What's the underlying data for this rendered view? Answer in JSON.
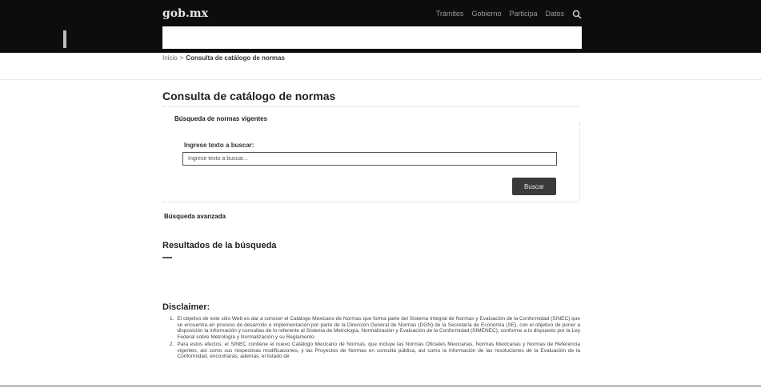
{
  "header": {
    "logo": "gob.mx",
    "nav": [
      "Trámites",
      "Gobierno",
      "Participa",
      "Datos"
    ],
    "search_icon": "search-icon"
  },
  "breadcrumb": {
    "home": "Inicio",
    "separator": ">",
    "current": "Consulta de catálogo de normas"
  },
  "page": {
    "title": "Consulta de catálogo de normas"
  },
  "search": {
    "section_label": "Búsqueda de normas vigentes",
    "field_label": "Ingrese texto a buscar:",
    "input_value": "Ingrese texto a buscar...",
    "button_label": "Buscar",
    "advanced_label": "Búsqueda avanzada"
  },
  "results": {
    "title": "Resultados de la búsqueda"
  },
  "disclaimer": {
    "title": "Disclaimer:",
    "items": [
      {
        "num": "1.",
        "text": "El objetivo de este sitio Web es dar a conocer el Catálogo Mexicano de Normas que forma parte del Sistema Integral de Normas y Evaluación de la Conformidad (SINEC) que se encuentra en proceso de desarrollo e implementación por parte de la Dirección General de Normas (DGN) de la Secretaría de Economía (SE), con el objetivo de poner a disposición la información y consultas de lo referente al Sistema de Metrología, Normalización y Evaluación de la Conformidad (SIMENEC), conforme a lo dispuesto por la Ley Federal sobre Metrología y Normalización y su Reglamento."
      },
      {
        "num": "2.",
        "text": "Para estos efectos, el SINEC contiene el nuevo Catálogo Mexicano de Normas, que incluye las Normas Oficiales Mexicanas, Normas Mexicanas y Normas de Referencia vigentes, así como sus respectivas modificaciones, y las Proyectos de Normas en consulta pública, así como la información de las resoluciones de la Evaluación de la Conformidad, encontrarás, además, el listado de"
      }
    ]
  },
  "colors": {
    "topbar": "#0d0d0d",
    "button": "#3a3a3a",
    "text": "#222222"
  }
}
